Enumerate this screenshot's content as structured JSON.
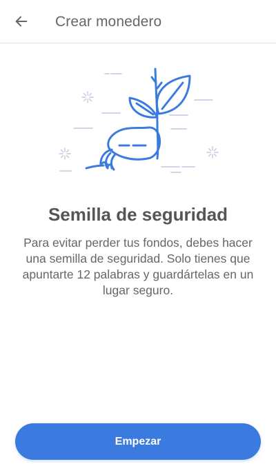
{
  "header": {
    "back_icon": "arrow-left-icon",
    "title": "Crear monedero"
  },
  "illustration": {
    "icon": "seed-sprout-illustration",
    "accent_color": "#3b7be0",
    "decor_color": "#c9c4e3"
  },
  "main": {
    "title": "Semilla de seguridad",
    "description": "Para evitar perder tus fondos, debes hacer una semilla de seguridad. Solo tienes que apuntarte 12 palabras y guardártelas en un lugar seguro."
  },
  "footer": {
    "start_label": "Empezar",
    "button_color": "#3b7be0"
  }
}
